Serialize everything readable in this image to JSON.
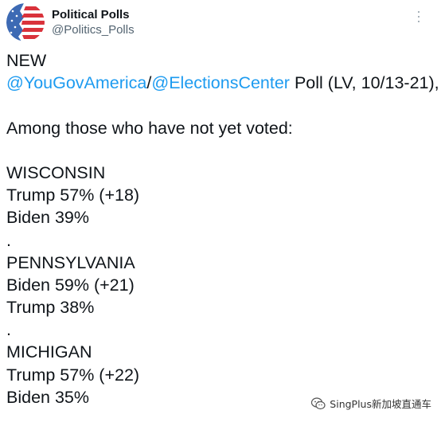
{
  "tweet": {
    "author": {
      "display_name": "Political Polls",
      "handle": "@Politics_Polls",
      "avatar_icon": "flag-logo-icon",
      "avatar_colors": {
        "blue": "#3d6ab4",
        "red": "#d9323b",
        "white": "#ffffff"
      }
    },
    "more_icon": "more-options-icon",
    "lines": {
      "l1": "NEW",
      "mention1": "@YouGovAmerica",
      "slash": "/",
      "mention2": "@ElectionsCenter",
      "poll_info": " Poll (LV, 10/13-21),",
      "l3": "Among those who have not yet voted:",
      "wi_state": "WISCONSIN",
      "wi_trump": "Trump 57% (+18)",
      "wi_biden": "Biden 39%",
      "sep1": ".",
      "pa_state": "PENNSYLVANIA",
      "pa_biden": "Biden 59% (+21)",
      "pa_trump": "Trump 38%",
      "sep2": ".",
      "mi_state": "MICHIGAN",
      "mi_trump": "Trump 57% (+22)",
      "mi_biden": "Biden 35%"
    },
    "mention_color": "#1d9bf0"
  },
  "watermark": {
    "text": "SingPlus新加坡直通车",
    "icon": "wechat-icon"
  }
}
